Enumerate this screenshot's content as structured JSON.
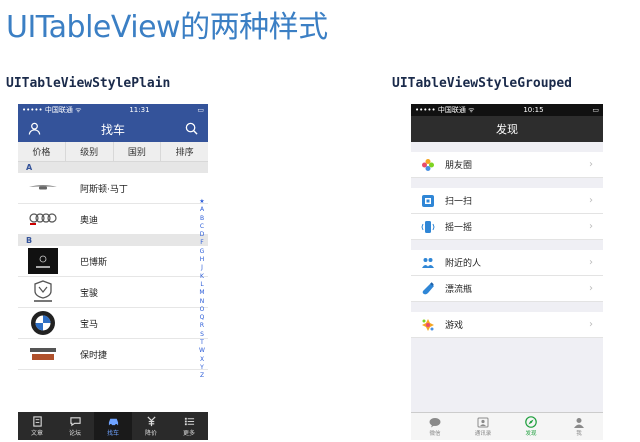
{
  "slide": {
    "title": "UITableView的两种样式",
    "left_label": "UITableViewStylePlain",
    "right_label": "UITableViewStyleGrouped"
  },
  "plain": {
    "status": {
      "carrier": "••••• 中国联通 ᯤ",
      "time": "11:31",
      "battery": "▭"
    },
    "nav_title": "找车",
    "segments": [
      "价格",
      "级别",
      "国别",
      "排序"
    ],
    "sections": [
      {
        "header": "A",
        "rows": [
          "阿斯顿·马丁",
          "奥迪"
        ]
      },
      {
        "header": "B",
        "rows": [
          "巴博斯",
          "宝骏",
          "宝马",
          "保时捷"
        ]
      }
    ],
    "index": [
      "★",
      "A",
      "B",
      "C",
      "D",
      "F",
      "G",
      "H",
      "J",
      "K",
      "L",
      "M",
      "N",
      "O",
      "Q",
      "R",
      "S",
      "T",
      "W",
      "X",
      "Y",
      "Z"
    ],
    "tabs": [
      {
        "label": "文章",
        "icon": "document-icon"
      },
      {
        "label": "论坛",
        "icon": "chat-icon"
      },
      {
        "label": "找车",
        "icon": "car-icon"
      },
      {
        "label": "降价",
        "icon": "price-icon"
      },
      {
        "label": "更多",
        "icon": "list-icon"
      }
    ],
    "active_tab": 2,
    "colors": {
      "nav": "#34539a",
      "index": "#2a5bd7"
    }
  },
  "grouped": {
    "status": {
      "carrier": "••••• 中国联通 ᯤ",
      "time": "10:15",
      "battery": "▭"
    },
    "nav_title": "发现",
    "groups": [
      [
        {
          "label": "朋友圈",
          "icon": "moments-icon"
        }
      ],
      [
        {
          "label": "扫一扫",
          "icon": "scan-icon"
        },
        {
          "label": "摇一摇",
          "icon": "shake-icon"
        }
      ],
      [
        {
          "label": "附近的人",
          "icon": "nearby-icon"
        },
        {
          "label": "漂流瓶",
          "icon": "bottle-icon"
        }
      ],
      [
        {
          "label": "游戏",
          "icon": "game-icon"
        }
      ]
    ],
    "tabs": [
      {
        "label": "微信",
        "icon": "chat-bubble-icon"
      },
      {
        "label": "通讯录",
        "icon": "contacts-icon"
      },
      {
        "label": "发现",
        "icon": "compass-icon"
      },
      {
        "label": "我",
        "icon": "person-icon"
      }
    ],
    "active_tab": 2,
    "colors": {
      "nav": "#2d2d2d",
      "active": "#1e9f3d"
    }
  }
}
